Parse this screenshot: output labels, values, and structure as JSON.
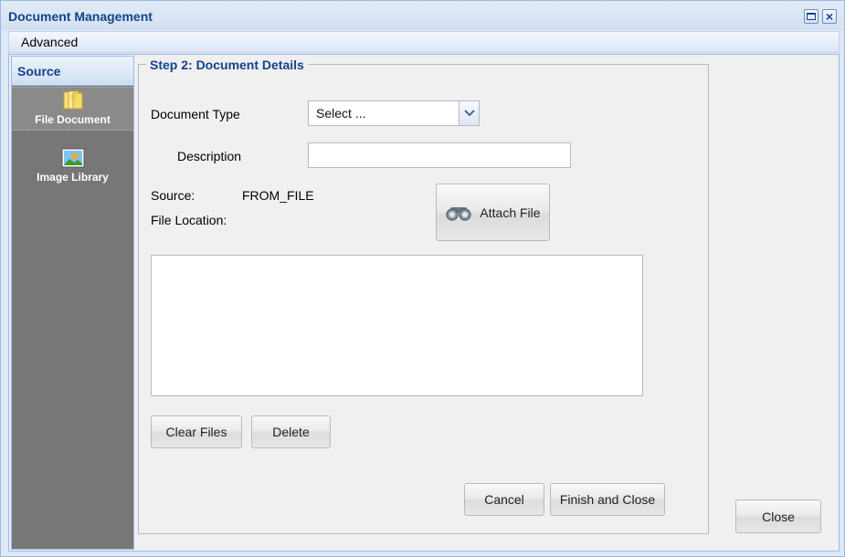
{
  "window": {
    "title": "Document Management"
  },
  "menu": {
    "advanced": "Advanced"
  },
  "sidebar": {
    "header": "Source",
    "items": [
      {
        "label": "File Document",
        "icon": "folder-icon",
        "selected": true
      },
      {
        "label": "Image Library",
        "icon": "image-icon",
        "selected": false
      }
    ]
  },
  "form": {
    "legend": "Step 2: Document Details",
    "document_type_label": "Document Type",
    "document_type_value": "Select ...",
    "description_label": "Description",
    "description_value": "",
    "source_label": "Source:",
    "source_value": "FROM_FILE",
    "file_location_label": "File Location:",
    "attach_button": "Attach File",
    "clear_button": "Clear Files",
    "delete_button": "Delete",
    "cancel_button": "Cancel",
    "finish_button": "Finish and Close"
  },
  "footer": {
    "close_button": "Close"
  },
  "colors": {
    "accent": "#15428b",
    "panel_border": "#99bbe8",
    "sidebar_bg": "#777777"
  }
}
